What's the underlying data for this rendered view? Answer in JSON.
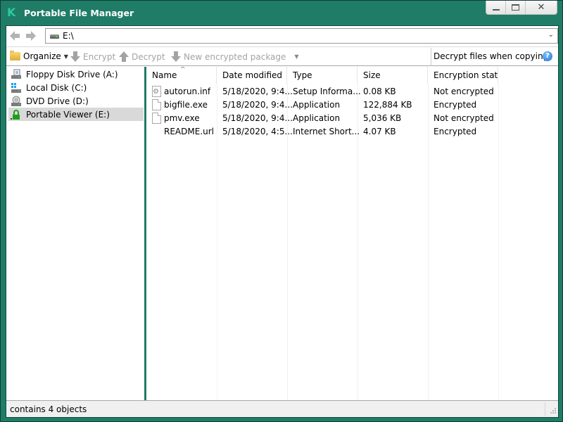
{
  "window": {
    "title": "Portable File Manager",
    "logo_glyph": "K",
    "controls": {
      "minimize": "minimize",
      "maximize": "maximize",
      "close": "✕"
    }
  },
  "navigation": {
    "back_icon": "arrow-left-icon",
    "forward_icon": "arrow-right-icon",
    "address": "E:\\",
    "dropdown_glyph": "⌄"
  },
  "toolbar": {
    "organize": "Organize",
    "encrypt": "Encrypt",
    "decrypt": "Decrypt",
    "new_package": "New encrypted package",
    "decrypt_when_copying": "Decrypt files when copying",
    "help_glyph": "?"
  },
  "tree": {
    "items": [
      {
        "label": "Floppy Disk Drive (A:)",
        "icon": "floppy-drive-icon",
        "selected": false
      },
      {
        "label": "Local Disk (C:)",
        "icon": "local-disk-icon",
        "selected": false
      },
      {
        "label": "DVD Drive (D:)",
        "icon": "dvd-drive-icon",
        "selected": false
      },
      {
        "label": "Portable Viewer (E:)",
        "icon": "locked-drive-icon",
        "selected": true
      }
    ]
  },
  "list": {
    "sort_indicator": "^",
    "columns": [
      "Name",
      "Date modified",
      "Type",
      "Size",
      "Encryption stat..."
    ],
    "rows": [
      {
        "name": "autorun.inf",
        "date": "5/18/2020, 9:4...",
        "type": "Setup Informa...",
        "size": "0.08 KB",
        "encryption": "Not encrypted",
        "icon": "settings-file-icon"
      },
      {
        "name": "bigfile.exe",
        "date": "5/18/2020, 9:4...",
        "type": "Application",
        "size": "122,884 KB",
        "encryption": "Encrypted",
        "icon": "file-icon"
      },
      {
        "name": "pmv.exe",
        "date": "5/18/2020, 9:4...",
        "type": "Application",
        "size": "5,036 KB",
        "encryption": "Not encrypted",
        "icon": "file-icon"
      },
      {
        "name": "README.url",
        "date": "5/18/2020, 4:5...",
        "type": "Internet Short...",
        "size": "4.07 KB",
        "encryption": "Encrypted",
        "icon": "none"
      }
    ]
  },
  "status": {
    "text": "contains 4 objects"
  },
  "colors": {
    "frame": "#1f7c67",
    "accent": "#2ac9a0",
    "selection": "#d9d9d9"
  }
}
